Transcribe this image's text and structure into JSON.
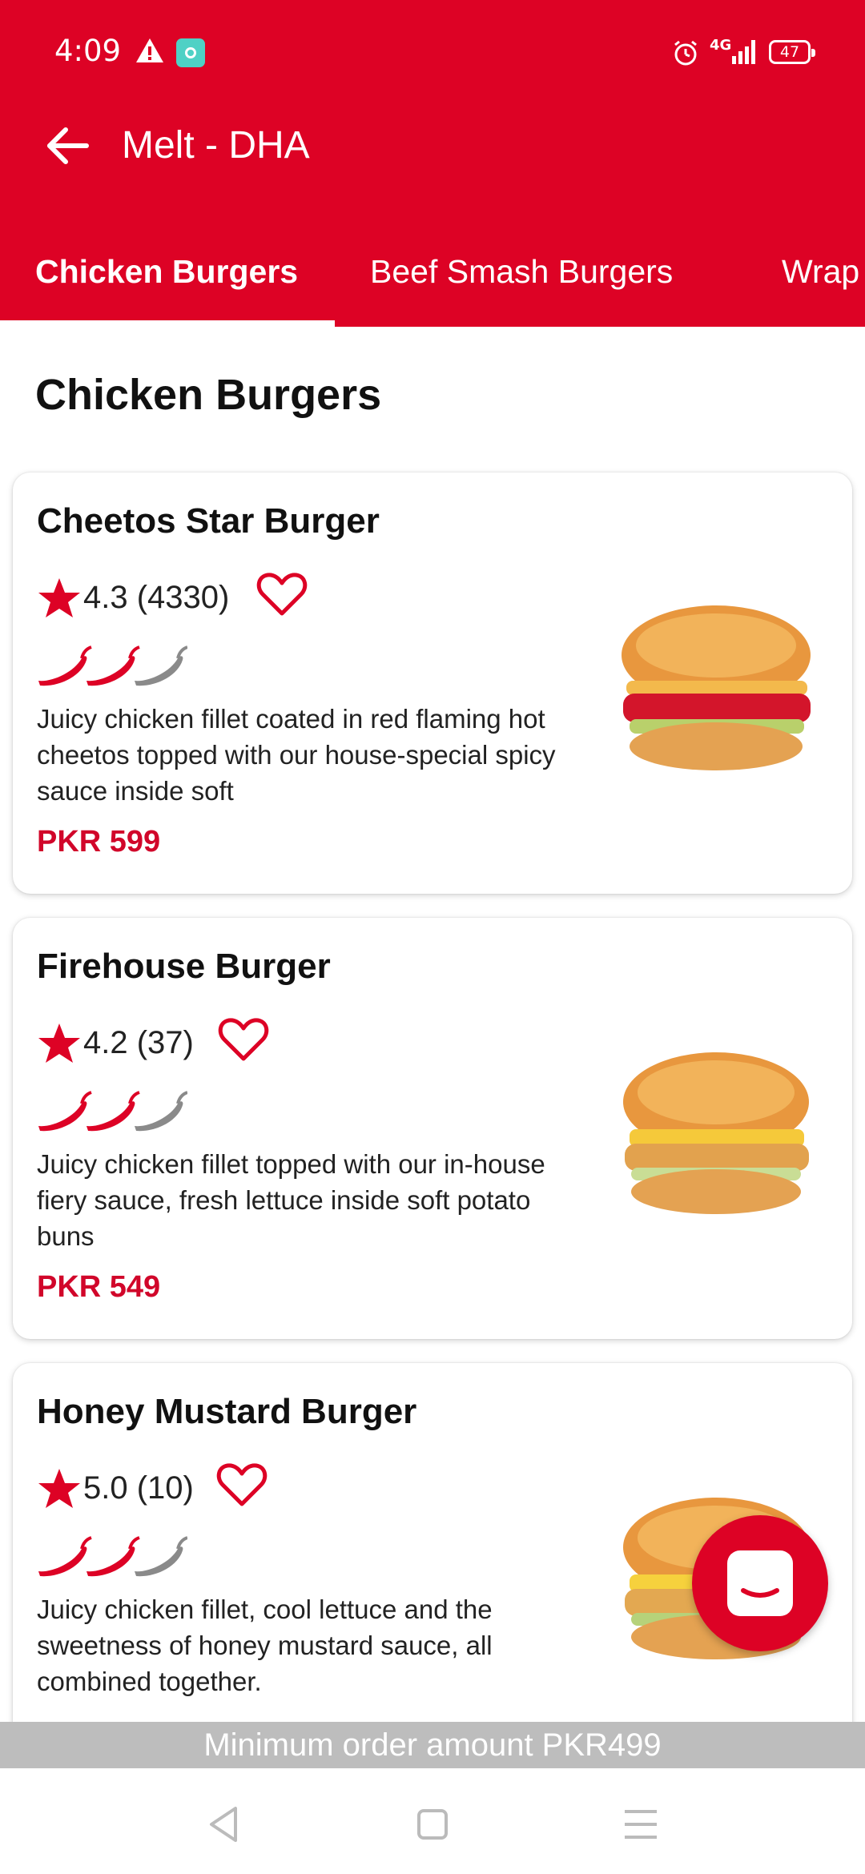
{
  "status_bar": {
    "time": "4:09",
    "network": "4G",
    "battery": "47"
  },
  "header": {
    "title": "Melt - DHA",
    "back_icon": "arrow-left-icon"
  },
  "tabs": [
    {
      "label": "Chicken Burgers",
      "active": true
    },
    {
      "label": "Beef Smash Burgers",
      "active": false
    },
    {
      "label": "Wrap",
      "active": false
    }
  ],
  "section": {
    "title": "Chicken Burgers"
  },
  "items": [
    {
      "name": "Cheetos Star Burger",
      "rating": "4.3 (4330)",
      "spice_level": 2,
      "spice_max": 3,
      "description": "Juicy chicken fillet coated in red flaming hot cheetos topped with our house-special spicy sauce inside soft",
      "price": "PKR 599"
    },
    {
      "name": "Firehouse Burger",
      "rating": "4.2 (37)",
      "spice_level": 2,
      "spice_max": 3,
      "description": "Juicy chicken fillet topped with our in-house fiery sauce, fresh lettuce inside soft potato buns",
      "price": "PKR 549"
    },
    {
      "name": "Honey Mustard Burger",
      "rating": "5.0 (10)",
      "spice_level": 2,
      "spice_max": 3,
      "description": "Juicy chicken fillet, cool lettuce and the sweetness of honey mustard sauce, all combined together.",
      "price": ""
    }
  ],
  "footer": {
    "min_order": "Minimum order amount PKR499"
  },
  "colors": {
    "brand_red": "#dd0225",
    "price_red": "#d1062a",
    "star_red": "#dd0225",
    "chili_inactive": "#8a8a8a",
    "min_order_bg": "#bdbdbd"
  }
}
